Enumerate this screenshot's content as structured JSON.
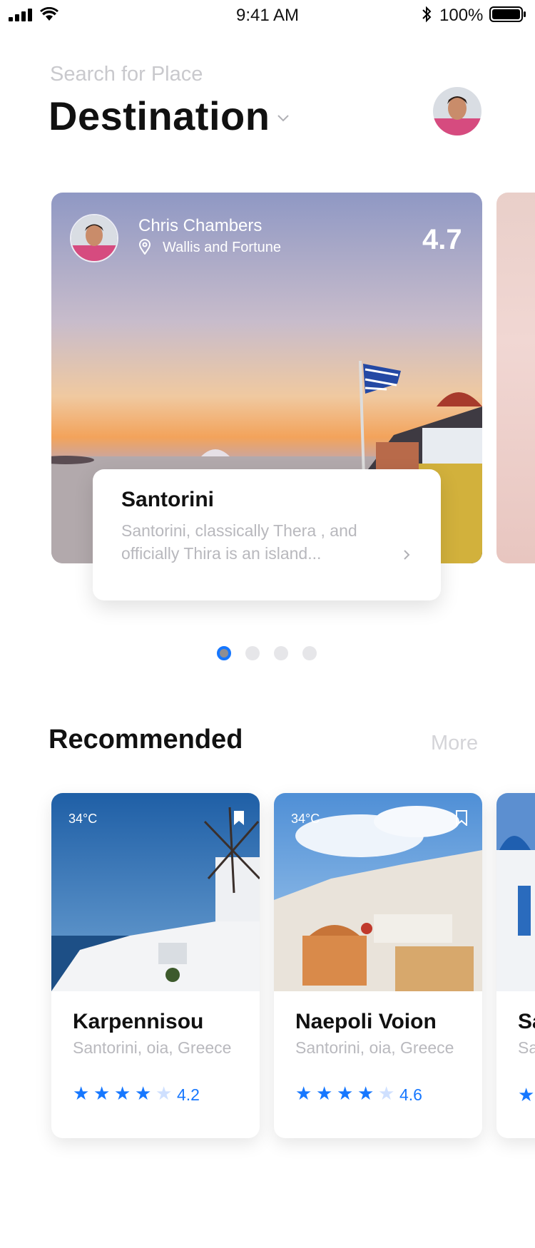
{
  "status_bar": {
    "time": "9:41 AM",
    "battery": "100%"
  },
  "header": {
    "search_label": "Search for Place",
    "title": "Destination"
  },
  "featured": {
    "user_name": "Chris Chambers",
    "user_location": "Wallis and Fortune",
    "rating": "4.7",
    "place_title": "Santorini",
    "place_description": "Santorini, classically Thera , and officially Thira is an island...",
    "page_count": 4,
    "active_page": 1
  },
  "recommended": {
    "title": "Recommended",
    "more_label": "More",
    "items": [
      {
        "temp": "34°C",
        "name": "Karpennisou",
        "place": "Santorini, oia, Greece",
        "stars": 4,
        "score": "4.2"
      },
      {
        "temp": "34°C",
        "name": "Naepoli Voion",
        "place": "Santorini, oia, Greece",
        "stars": 4,
        "score": "4.6"
      },
      {
        "name": "Sa",
        "place": "Sa"
      }
    ]
  },
  "colors": {
    "accent": "#1677ff",
    "muted_text": "#b8b8bd",
    "title_text": "#111111"
  }
}
